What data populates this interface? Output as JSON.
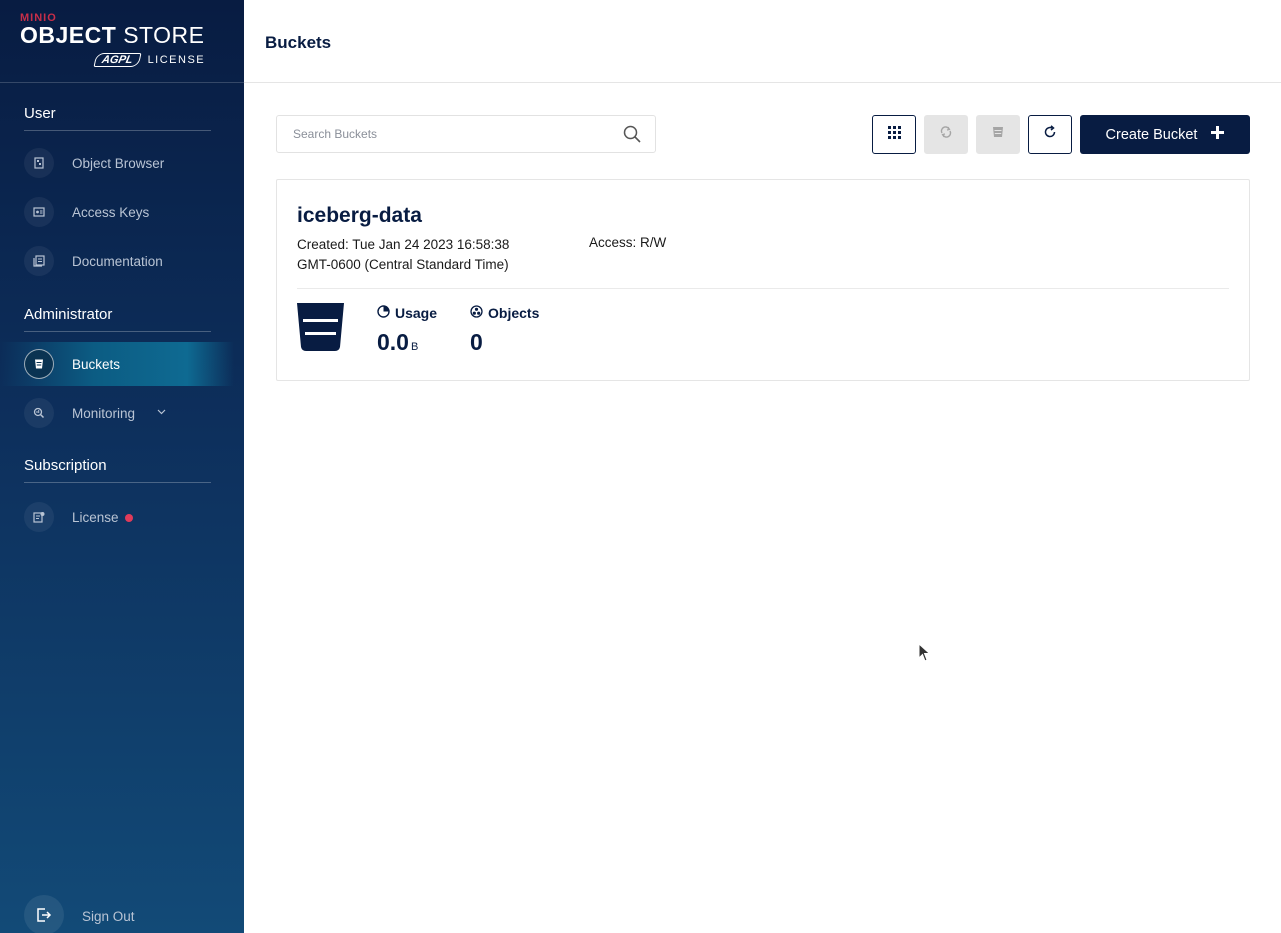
{
  "brand": {
    "mini": "MINIO",
    "main_bold": "OBJECT",
    "main_light": "STORE",
    "agpl": "AGPL",
    "license": "LICENSE"
  },
  "sidebar": {
    "sections": [
      {
        "title": "User",
        "items": [
          {
            "label": "Object Browser",
            "icon": "object-browser-icon"
          },
          {
            "label": "Access Keys",
            "icon": "access-keys-icon"
          },
          {
            "label": "Documentation",
            "icon": "documentation-icon"
          }
        ]
      },
      {
        "title": "Administrator",
        "items": [
          {
            "label": "Buckets",
            "icon": "bucket-icon",
            "active": true
          },
          {
            "label": "Monitoring",
            "icon": "monitoring-icon",
            "expandable": true
          }
        ]
      },
      {
        "title": "Subscription",
        "items": [
          {
            "label": "License",
            "icon": "license-icon",
            "badge": "red-dot"
          }
        ]
      }
    ],
    "sign_out": "Sign Out"
  },
  "header": {
    "title": "Buckets"
  },
  "toolbar": {
    "search_placeholder": "Search Buckets",
    "create_label": "Create Bucket"
  },
  "buckets": [
    {
      "name": "iceberg-data",
      "created_line1": "Created: Tue Jan 24 2023 16:58:38",
      "created_line2": "GMT-0600 (Central Standard Time)",
      "access": "Access: R/W",
      "usage_label": "Usage",
      "usage_value": "0.0",
      "usage_unit": "B",
      "objects_label": "Objects",
      "objects_value": "0"
    }
  ],
  "colors": {
    "primary": "#081c42",
    "active_nav": "#0e6a92",
    "badge": "#e03b5a"
  }
}
